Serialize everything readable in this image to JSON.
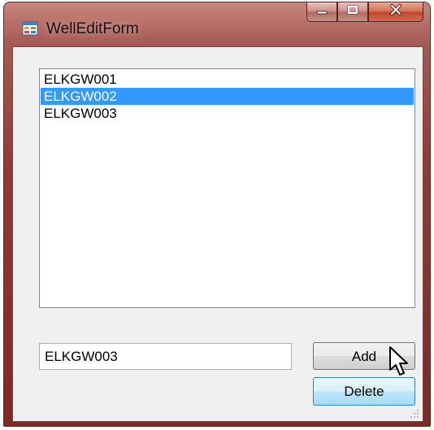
{
  "window": {
    "title": "WellEditForm"
  },
  "icons": {
    "app": "form-app-icon",
    "minimize": "minimize-icon",
    "maximize": "maximize-icon",
    "close": "close-icon",
    "cursor": "mouse-pointer-icon",
    "grip": "size-grip-icon"
  },
  "colors": {
    "selection": "#3399ff",
    "title_frame": "#8f3a33",
    "close_button": "#c0452d",
    "hover_button": "#bee6fd"
  },
  "wells": {
    "items": [
      "ELKGW001",
      "ELKGW002",
      "ELKGW003"
    ],
    "selected_index": 1
  },
  "name_input": {
    "value": "ELKGW003"
  },
  "buttons": {
    "add_label": "Add",
    "delete_label": "Delete"
  }
}
